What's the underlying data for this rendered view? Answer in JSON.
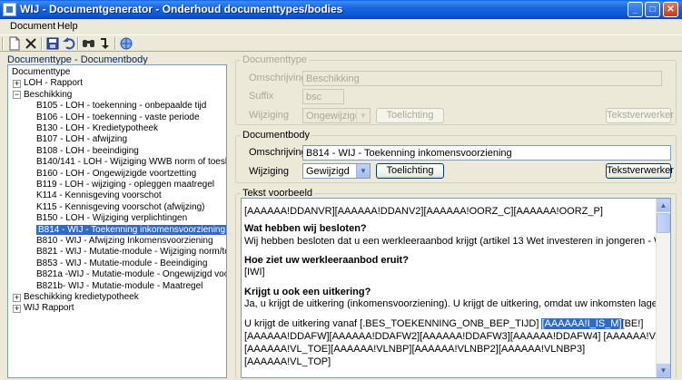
{
  "window": {
    "title": "WIJ - Documentgenerator - Onderhoud documenttypes/bodies"
  },
  "menu": [
    "Document",
    "Help"
  ],
  "toolbar": {
    "icons": [
      "new-icon",
      "delete-icon",
      "save-icon",
      "undo-icon",
      "search-icon",
      "goto-icon",
      "globe-icon"
    ]
  },
  "left": {
    "header": "Documenttype - Documentbody",
    "tree": [
      {
        "label": "Documenttype",
        "level": 0,
        "expander": ""
      },
      {
        "label": "LOH - Rapport",
        "level": 1,
        "expander": "+"
      },
      {
        "label": "Beschikking",
        "level": 1,
        "expander": "−"
      },
      {
        "label": "B105 - LOH - toekenning - onbepaalde tijd",
        "level": 2
      },
      {
        "label": "B106 - LOH - toekenning - vaste periode",
        "level": 2
      },
      {
        "label": "B130 - LOH - Kredietypotheek",
        "level": 2
      },
      {
        "label": "B107 - LOH - afwijzing",
        "level": 2
      },
      {
        "label": "B108 - LOH - beeindiging",
        "level": 2
      },
      {
        "label": "B140/141 - LOH - Wijziging WWB norm of toeslag/kortir",
        "level": 2
      },
      {
        "label": "B160 - LOH - Ongewijzigde voortzetting",
        "level": 2
      },
      {
        "label": "B119 - LOH - wijziging - opleggen maatregel",
        "level": 2
      },
      {
        "label": "K114 - Kennisgeving voorschot",
        "level": 2
      },
      {
        "label": "K115 - Kennisgeving voorschot (afwijzing)",
        "level": 2
      },
      {
        "label": "B150 - LOH - Wijziging verplichtingen",
        "level": 2
      },
      {
        "label": "B814 - WIJ - Toekenning inkomensvoorziening",
        "level": 2,
        "selected": true
      },
      {
        "label": "B810 - WIJ - Afwijzing Inkomensvoorziening",
        "level": 2
      },
      {
        "label": "B821 - WIJ - Mutatie-module - Wijziging norm/toeslag/ko",
        "level": 2
      },
      {
        "label": "B853 - WIJ - Mutatie-module - Beeindiging",
        "level": 2
      },
      {
        "label": "B821a -WIJ - Mutatie-module - Ongewijzigd voortzetten",
        "level": 2
      },
      {
        "label": "B821b- WIJ - Mutatie-module - Maatregel",
        "level": 2
      },
      {
        "label": "Beschikking kredietypotheek",
        "level": 1,
        "expander": "+"
      },
      {
        "label": "WIJ Rapport",
        "level": 1,
        "expander": "+"
      }
    ]
  },
  "documenttype": {
    "group_label": "Documenttype",
    "omschrijving_label": "Omschrijving",
    "omschrijving_value": "Beschikking",
    "suffix_label": "Suffix",
    "suffix_value": "bsc",
    "wijziging_label": "Wijziging",
    "wijziging_value": "Ongewijzigd",
    "toelichting_button": "Toelichting",
    "tekstverwerker_button": "Tekstverwerker"
  },
  "documentbody": {
    "group_label": "Documentbody",
    "omschrijving_label": "Omschrijving",
    "omschrijving_value": "B814  - WIJ - Toekenning inkomensvoorziening",
    "wijziging_label": "Wijziging",
    "wijziging_value": "Gewijzigd",
    "toelichting_button": "Toelichting",
    "tekstverwerker_button": "Tekstverwerker"
  },
  "preview": {
    "group_label": "Tekst voorbeeld",
    "line1": "[AAAAAA!DDANVR][AAAAAA!DDANV2][AAAAAA!OORZ_C][AAAAAA!OORZ_P]",
    "h1": "Wat hebben wij besloten?",
    "line2": "Wij hebben besloten dat u een werkleeraanbod krijgt (artikel 13 Wet investeren in jongeren - WIJ). Wij",
    "h2": "Hoe ziet uw werkleeraanbod eruit?",
    "line3": "[IWI]",
    "h3": "Krijgt u ook een uitkering?",
    "line4": "Ja, u krijgt de uitkering (inkomensvoorziening). U krijgt de uitkering, omdat uw inkomsten lager z",
    "line5a": "U krijgt de uitkering vanaf [.BES_TOEKENNING_ONB_BEP_TIJD] ",
    "line5hl": "[AAAAAA!I_IS_M]",
    "line5b": "[BE!]",
    "line6": "[AAAAAA!DDAFW][AAAAAA!DDAFW2][AAAAAA!DDAFW3][AAAAAA!DDAFW4] [AAAAAA!VL_NBS",
    "line7": "[AAAAAA!VL_TOE][AAAAAA!VLNBP][AAAAAA!VLNBP2][AAAAAA!VLNBP3]",
    "line8": "[AAAAAA!VL_TOP]"
  }
}
